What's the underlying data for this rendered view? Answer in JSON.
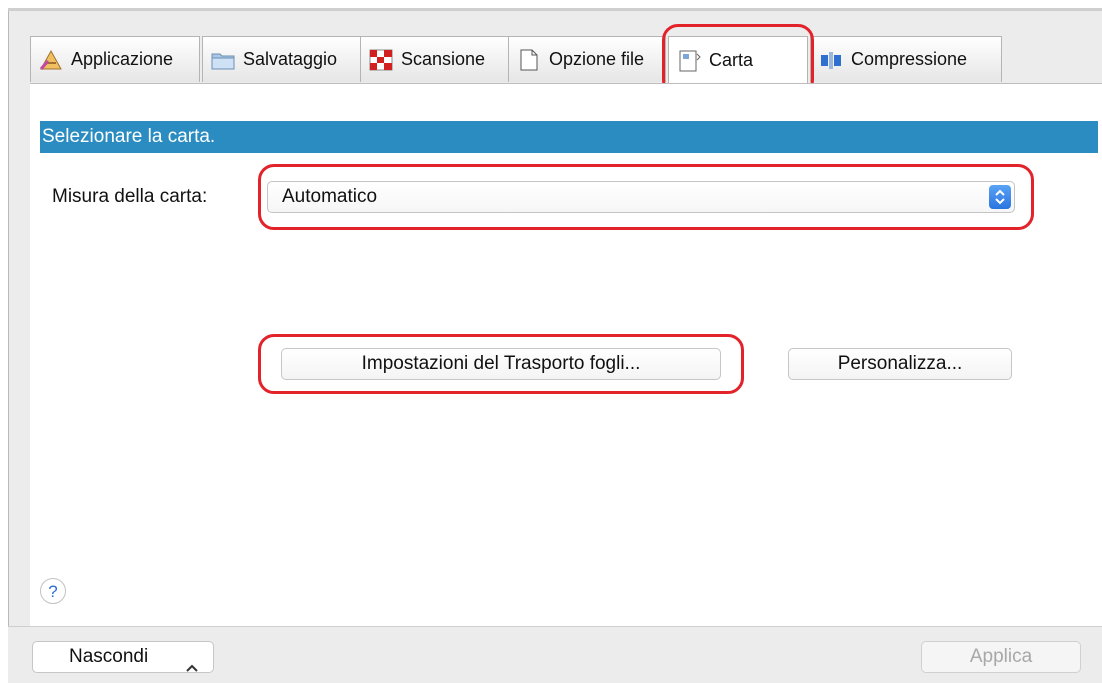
{
  "tabs": [
    {
      "label": "Applicazione",
      "icon": "application-icon"
    },
    {
      "label": "Salvataggio",
      "icon": "folder-icon"
    },
    {
      "label": "Scansione",
      "icon": "scan-icon"
    },
    {
      "label": "Opzione file",
      "icon": "file-icon"
    },
    {
      "label": "Carta",
      "icon": "paper-icon",
      "active": true
    },
    {
      "label": "Compressione",
      "icon": "compression-icon"
    }
  ],
  "section": {
    "title": "Selezionare la carta."
  },
  "paper_size": {
    "label": "Misura della carta:",
    "value": "Automatico"
  },
  "buttons": {
    "transport": "Impostazioni del Trasporto fogli...",
    "customize": "Personalizza..."
  },
  "help": {
    "symbol": "?"
  },
  "bottom": {
    "hide_label": "Nascondi",
    "apply_label": "Applica"
  },
  "colors": {
    "section_bar": "#2a8cc0",
    "highlight": "#e2232a"
  }
}
